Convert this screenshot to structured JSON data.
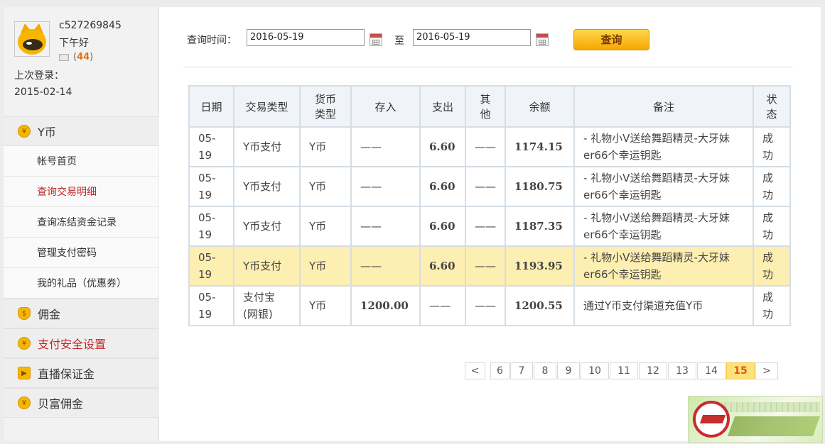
{
  "user": {
    "username": "c527269845",
    "greeting": "下午好",
    "message_count": "44",
    "message_prefix": "(",
    "message_suffix": ")",
    "last_login_label": "上次登录：",
    "last_login_date": "2015-02-14"
  },
  "nav": {
    "sections": [
      {
        "label": "Y币",
        "icon": "coin-icon"
      },
      {
        "label": "佣金",
        "icon": "money-bag-icon"
      },
      {
        "label": "支付安全设置",
        "icon": "shield-coin-icon"
      },
      {
        "label": "直播保证金",
        "icon": "play-icon"
      },
      {
        "label": "贝富佣金",
        "icon": "coin-icon"
      }
    ],
    "subitems": [
      {
        "label": "帐号首页"
      },
      {
        "label": "查询交易明细"
      },
      {
        "label": "查询冻结资金记录"
      },
      {
        "label": "管理支付密码"
      },
      {
        "label": "我的礼品（优惠券）"
      }
    ]
  },
  "query": {
    "label": "查询时间：",
    "from": "2016-05-19",
    "to_label": "至",
    "to": "2016-05-19",
    "button": "查询"
  },
  "table": {
    "headers": [
      "日期",
      "交易类型",
      "货币\n类型",
      "存入",
      "支出",
      "其\n他",
      "余额",
      "备注",
      "状\n态"
    ],
    "rows": [
      {
        "date": "05-\n19",
        "type": "Y币支付",
        "currency": "Y币",
        "deposit": "——",
        "expense": "6.60",
        "other": "——",
        "balance": "1174.15",
        "note": "- 礼物小V送给舞蹈精灵-大牙妹er66个幸运钥匙",
        "status": "成\n功"
      },
      {
        "date": "05-\n19",
        "type": "Y币支付",
        "currency": "Y币",
        "deposit": "——",
        "expense": "6.60",
        "other": "——",
        "balance": "1180.75",
        "note": "- 礼物小V送给舞蹈精灵-大牙妹er66个幸运钥匙",
        "status": "成\n功"
      },
      {
        "date": "05-\n19",
        "type": "Y币支付",
        "currency": "Y币",
        "deposit": "——",
        "expense": "6.60",
        "other": "——",
        "balance": "1187.35",
        "note": "- 礼物小V送给舞蹈精灵-大牙妹er66个幸运钥匙",
        "status": "成\n功"
      },
      {
        "date": "05-\n19",
        "type": "Y币支付",
        "currency": "Y币",
        "deposit": "——",
        "expense": "6.60",
        "other": "——",
        "balance": "1193.95",
        "note": "- 礼物小V送给舞蹈精灵-大牙妹er66个幸运钥匙",
        "status": "成\n功"
      },
      {
        "date": "05-\n19",
        "type": "支付宝\n(网银)",
        "currency": "Y币",
        "deposit": "1200.00",
        "expense": "——",
        "other": "——",
        "balance": "1200.55",
        "note": "通过Y币支付渠道充值Y币",
        "status": "成\n功"
      }
    ]
  },
  "pager": {
    "prev": "<",
    "next": ">",
    "pages": [
      "6",
      "7",
      "8",
      "9",
      "10",
      "11",
      "12",
      "13",
      "14",
      "15"
    ],
    "current": "15"
  },
  "colors": {
    "accent_red": "#c0292b",
    "amount": "#b4124f",
    "highlight_row": "#fdeeb1",
    "button": "#f5a800"
  }
}
